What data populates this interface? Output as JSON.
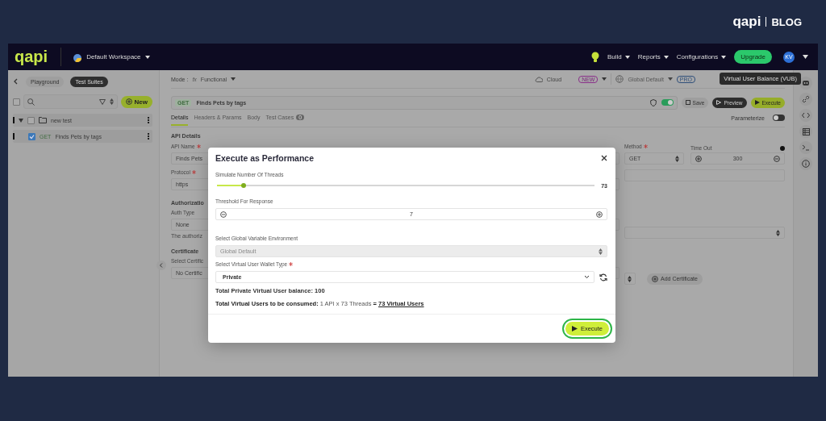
{
  "blog_header": {
    "logo": "qapi",
    "label": "BLOG"
  },
  "topbar": {
    "logo": "qapi",
    "workspace": "Default Workspace",
    "menus": [
      {
        "label": "Build"
      },
      {
        "label": "Reports"
      },
      {
        "label": "Configurations"
      }
    ],
    "upgrade": "Upgrade",
    "avatar": "KV"
  },
  "sidebar": {
    "tabs": [
      {
        "label": "Playground",
        "selected": false
      },
      {
        "label": "Test Suites",
        "selected": true
      }
    ],
    "select_all_checked": false,
    "new_button": "New",
    "tree": [
      {
        "kind": "folder",
        "label": "new test",
        "checked": false,
        "expanded": true,
        "children": [
          {
            "kind": "request",
            "method": "GET",
            "label": "Finds Pets by tags",
            "checked": true
          }
        ]
      }
    ]
  },
  "main": {
    "mode_label": "Mode :",
    "mode_icon_text": "fx",
    "mode": "Functional",
    "cloud": "Cloud",
    "new_badge": "NEW",
    "environment": "Global Default",
    "pro_badge": "PRO",
    "tooltip": "Virtual User Balance (VUB)",
    "request": {
      "method": "GET",
      "name": "Finds Pets by tags",
      "toggle_on": true
    },
    "actions": [
      {
        "kind": "save",
        "label": "Save"
      },
      {
        "kind": "preview",
        "label": "Preview"
      },
      {
        "kind": "execute",
        "label": "Execute"
      }
    ],
    "tabs": [
      {
        "label": "Details",
        "selected": true
      },
      {
        "label": "Headers & Params",
        "selected": false
      },
      {
        "label": "Body",
        "selected": false
      },
      {
        "label": "Test Cases",
        "count": "0",
        "selected": false
      }
    ],
    "parameterize": {
      "label": "Parameterize",
      "on": false
    },
    "section_title": "API Details",
    "form_left": [
      {
        "kind": "label",
        "text": "API Name",
        "required": true
      },
      {
        "kind": "field",
        "text": "Finds Pets"
      },
      {
        "kind": "label",
        "text": "Protocol",
        "required": true
      },
      {
        "kind": "field",
        "text": "https"
      },
      {
        "kind": "heading",
        "text": "Authorizatio"
      },
      {
        "kind": "label",
        "text": "Auth Type"
      },
      {
        "kind": "field",
        "text": "None"
      },
      {
        "kind": "hint",
        "text": "The authoriz"
      },
      {
        "kind": "heading",
        "text": "Certificate"
      },
      {
        "kind": "label",
        "text": "Select Certific"
      },
      {
        "kind": "field",
        "text": "No Certific"
      }
    ],
    "method": {
      "label": "Method",
      "required": true,
      "value": "GET"
    },
    "timeout": {
      "label": "Time Out",
      "value": "300"
    },
    "add_certificate": "Add Certificate"
  },
  "modal": {
    "title": "Execute as Performance",
    "threads": {
      "label": "Simulate Number Of Threads",
      "level": 0.07,
      "value": "73"
    },
    "threshold": {
      "label": "Threshold For Response",
      "value": "7"
    },
    "environment": {
      "label": "Select Global Variable Environment",
      "value": "Global Default",
      "disabled": true
    },
    "wallet": {
      "label": "Select Virtual User Wallet Type",
      "required": true,
      "value": "Private"
    },
    "balance": "Total Private Virtual User balance: 100",
    "consumed": "**Total Virtual Users to be consumed:** 1 API x 73 Threads **=**",
    "consumed_total": "73 Virtual Users",
    "execute": {
      "label": "Execute",
      "highlighted": true
    }
  }
}
